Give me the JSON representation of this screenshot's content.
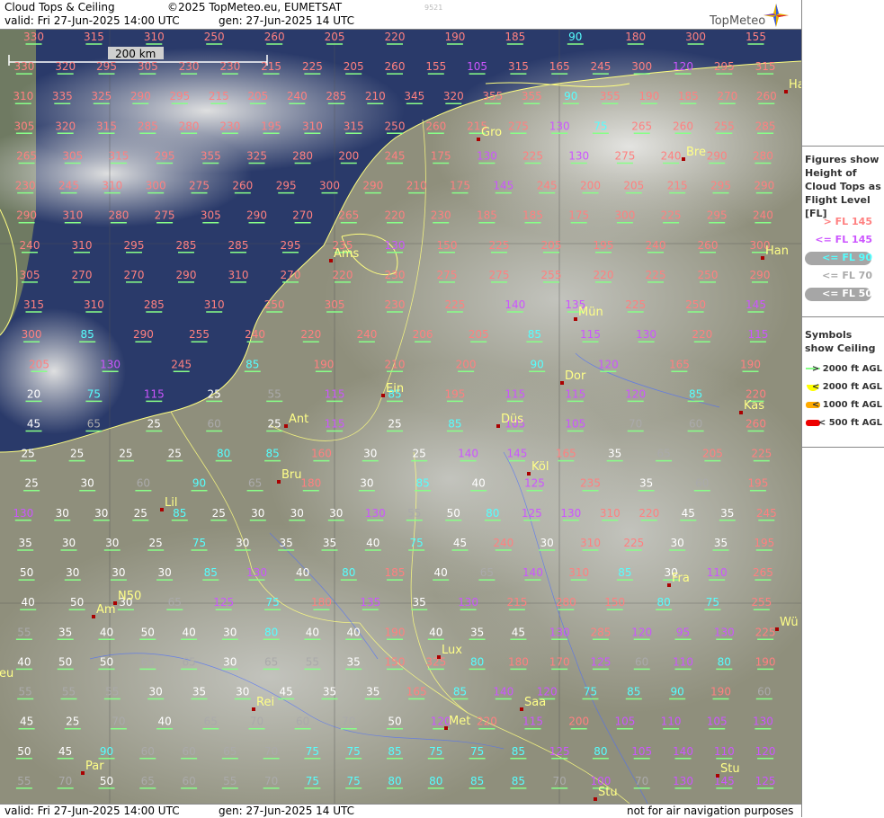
{
  "header": {
    "title": "Cloud Tops & Ceiling",
    "copyright": "©2025 TopMeteo.eu, EUMETSAT",
    "valid": "valid:  Fri  27-Jun-2025  14:00 UTC",
    "gen": "gen: 27-Jun-2025 14 UTC",
    "code": "9521",
    "logo_text": "TopMeteo"
  },
  "footer": {
    "valid": "valid:  Fri  27-Jun-2025  14:00 UTC",
    "gen": "gen: 27-Jun-2025 14 UTC",
    "disclaimer": "not for air navigation purposes"
  },
  "scale": {
    "label": "200 km"
  },
  "legend": {
    "heights_title": "Figures show Height of Cloud Tops as Flight Level  [FL]",
    "items": [
      {
        "label": "> FL 145",
        "color": "#ff8080",
        "pill": false
      },
      {
        "label": "<= FL 145",
        "color": "#cc55ff",
        "pill": false
      },
      {
        "label": "<= FL 90",
        "color": "#55ffff",
        "pill": true
      },
      {
        "label": "<= FL 70",
        "color": "#aaaaaa",
        "pill": false
      },
      {
        "label": "<= FL 50",
        "color": "#ffffff",
        "pill": true
      }
    ],
    "symbols_title": "Symbols show Ceiling",
    "symbols": [
      {
        "label": "> 2000 ft AGL",
        "kind": "line",
        "color": "#88ff88"
      },
      {
        "label": "< 2000 ft AGL",
        "kind": "half",
        "color": "#ffff00"
      },
      {
        "label": "< 1000 ft AGL",
        "kind": "bar",
        "color": "#ffaa00"
      },
      {
        "label": "< 500 ft AGL",
        "kind": "bar",
        "color": "#ee0000"
      }
    ]
  },
  "colors": {
    "high": "#ff8080",
    "mid": "#cc55ff",
    "low90": "#55ffff",
    "low70": "#aaaaaa",
    "low50": "#ffffff",
    "city": "#ffff88",
    "ceil_green": "#88ff88",
    "ceil_yellow": "#ffff00",
    "ceil_orange": "#ffaa00",
    "ceil_red": "#ee0000"
  },
  "cities": [
    "Gro",
    "Bre",
    "Ams",
    "Han",
    "Mün",
    "Ein",
    "Dor",
    "Ant",
    "Düs",
    "Kas",
    "Bru",
    "Köl",
    "Lil",
    "Fra",
    "Am",
    "N50",
    "Wü",
    "Lux",
    "Saa",
    "Rei",
    "Met",
    "Par",
    "Stu",
    "Stu",
    "Ha",
    "eu"
  ],
  "rows": [
    [
      "330",
      "315",
      "310",
      "250",
      "260",
      "205",
      "220",
      "190",
      "185",
      "90",
      "180",
      "300",
      "155"
    ],
    [
      "330",
      "320",
      "295",
      "305",
      "230",
      "230",
      "215",
      "225",
      "205",
      "260",
      "155",
      "105",
      "315",
      "165",
      "245",
      "300",
      "120",
      "295",
      "315"
    ],
    [
      "310",
      "335",
      "325",
      "290",
      "295",
      "215",
      "205",
      "240",
      "285",
      "210",
      "345",
      "320",
      "355",
      "355",
      "90",
      "355",
      "190",
      "185",
      "270",
      "260"
    ],
    [
      "305",
      "320",
      "315",
      "285",
      "280",
      "230",
      "195",
      "310",
      "315",
      "250",
      "260",
      "215",
      "275",
      "130",
      "75",
      "265",
      "260",
      "255",
      "285"
    ],
    [
      "265",
      "305",
      "315",
      "295",
      "355",
      "325",
      "280",
      "200",
      "245",
      "175",
      "130",
      "225",
      "130",
      "275",
      "240",
      "290",
      "280"
    ],
    [
      "230",
      "245",
      "310",
      "300",
      "275",
      "260",
      "295",
      "300",
      "290",
      "210",
      "175",
      "145",
      "245",
      "200",
      "205",
      "215",
      "295",
      "290"
    ],
    [
      "290",
      "310",
      "280",
      "275",
      "305",
      "290",
      "270",
      "265",
      "220",
      "230",
      "185",
      "185",
      "175",
      "300",
      "225",
      "295",
      "240"
    ],
    [
      "240",
      "310",
      "295",
      "285",
      "285",
      "295",
      "235",
      "130",
      "150",
      "225",
      "205",
      "195",
      "240",
      "260",
      "300"
    ],
    [
      "305",
      "270",
      "270",
      "290",
      "310",
      "270",
      "220",
      "230",
      "275",
      "275",
      "255",
      "220",
      "225",
      "250",
      "290"
    ],
    [
      "315",
      "310",
      "285",
      "310",
      "250",
      "305",
      "230",
      "225",
      "140",
      "135",
      "225",
      "250",
      "145"
    ],
    [
      "300",
      "85",
      "290",
      "255",
      "240",
      "220",
      "240",
      "206",
      "205",
      "85",
      "115",
      "130",
      "220",
      "115"
    ],
    [
      "205",
      "130",
      "245",
      "85",
      "190",
      "210",
      "200",
      "90",
      "120",
      "165",
      "190"
    ],
    [
      "20",
      "75",
      "115",
      "25",
      "55",
      "115",
      "85",
      "195",
      "115",
      "115",
      "120",
      "85",
      "220"
    ],
    [
      "45",
      "65",
      "25",
      "60",
      "25",
      "115",
      "25",
      "85",
      "105",
      "105",
      "70",
      "60",
      "260"
    ],
    [
      "25",
      "25",
      "25",
      "25",
      "80",
      "85",
      "160",
      "30",
      "25",
      "140",
      "145",
      "165",
      "35",
      "65",
      "205",
      "225"
    ],
    [
      "25",
      "30",
      "60",
      "90",
      "65",
      "180",
      "30",
      "85",
      "40",
      "125",
      "235",
      "35",
      "60",
      "195"
    ],
    [
      "130",
      "30",
      "30",
      "25",
      "85",
      "25",
      "30",
      "30",
      "30",
      "130",
      "55",
      "50",
      "80",
      "125",
      "130",
      "310",
      "220",
      "45",
      "35",
      "245"
    ],
    [
      "35",
      "30",
      "30",
      "25",
      "75",
      "30",
      "35",
      "35",
      "40",
      "75",
      "45",
      "240",
      "30",
      "310",
      "225",
      "30",
      "35",
      "195"
    ],
    [
      "50",
      "30",
      "30",
      "30",
      "85",
      "130",
      "40",
      "80",
      "185",
      "40",
      "65",
      "140",
      "310",
      "85",
      "30",
      "110",
      "265"
    ],
    [
      "40",
      "50",
      "30",
      "65",
      "125",
      "75",
      "180",
      "135",
      "35",
      "130",
      "215",
      "280",
      "150",
      "80",
      "75",
      "255"
    ],
    [
      "55",
      "35",
      "40",
      "50",
      "40",
      "30",
      "80",
      "40",
      "40",
      "190",
      "40",
      "35",
      "45",
      "130",
      "285",
      "120",
      "95",
      "130",
      "225"
    ],
    [
      "40",
      "50",
      "50",
      "65",
      "65",
      "30",
      "65",
      "55",
      "35",
      "150",
      "325",
      "80",
      "180",
      "170",
      "125",
      "60",
      "110",
      "80",
      "190"
    ],
    [
      "55",
      "55",
      "55",
      "30",
      "35",
      "30",
      "45",
      "35",
      "35",
      "165",
      "85",
      "140",
      "120",
      "75",
      "85",
      "90",
      "190",
      "60"
    ],
    [
      "45",
      "25",
      "70",
      "40",
      "65",
      "70",
      "60",
      "70",
      "50",
      "120",
      "220",
      "115",
      "200",
      "105",
      "110",
      "105",
      "130"
    ],
    [
      "50",
      "45",
      "90",
      "60",
      "60",
      "65",
      "70",
      "75",
      "75",
      "85",
      "75",
      "75",
      "85",
      "125",
      "80",
      "105",
      "140",
      "110",
      "120"
    ],
    [
      "55",
      "70",
      "50",
      "65",
      "60",
      "55",
      "70",
      "75",
      "75",
      "80",
      "80",
      "85",
      "85",
      "70",
      "100",
      "70",
      "130",
      "145",
      "125"
    ]
  ]
}
